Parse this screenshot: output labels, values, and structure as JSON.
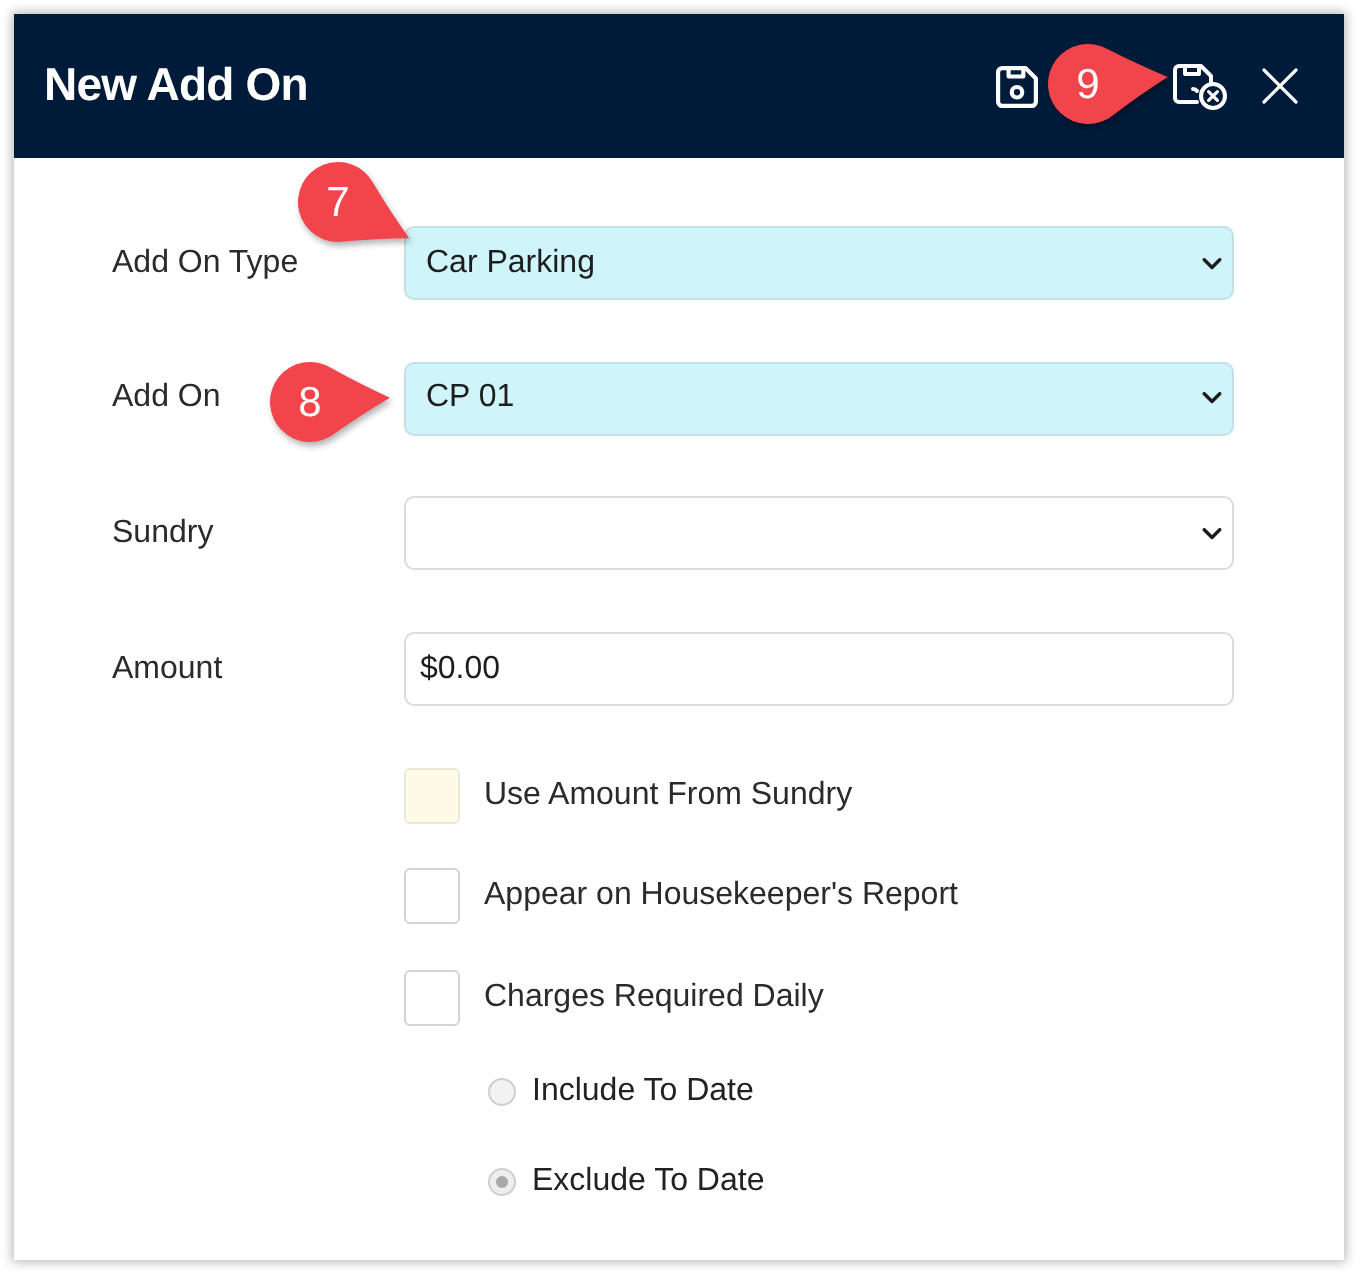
{
  "dialog": {
    "title": "New Add On",
    "buttons": [
      {
        "kind": "save"
      },
      {
        "kind": "save_close",
        "callout": "9"
      },
      {
        "kind": "close"
      }
    ]
  },
  "fields": [
    {
      "label": "Add On Type",
      "kind": "select",
      "value": "Car Parking",
      "highlighted": true,
      "callout": "7"
    },
    {
      "label": "Add On",
      "kind": "select",
      "value": "CP 01",
      "highlighted": true,
      "callout": "8"
    },
    {
      "label": "Sundry",
      "kind": "select",
      "highlighted": false
    },
    {
      "label": "Amount",
      "kind": "input",
      "value": "$0.00",
      "highlighted": false
    }
  ],
  "checkboxes": [
    {
      "label": "Use Amount From Sundry",
      "checked": false,
      "highlighted": true
    },
    {
      "label": "Appear on Housekeeper's Report",
      "checked": false,
      "highlighted": false
    },
    {
      "label": "Charges Required Daily",
      "checked": false,
      "highlighted": false
    }
  ],
  "radios": [
    {
      "label": "Include To Date",
      "selected": false,
      "disabled": true
    },
    {
      "label": "Exclude To Date",
      "selected": true,
      "disabled": true
    }
  ]
}
